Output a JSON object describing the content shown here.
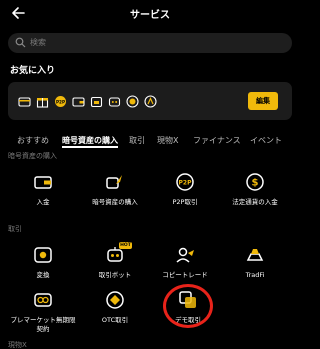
{
  "header": {
    "title": "サービス"
  },
  "search": {
    "placeholder": "検索"
  },
  "favorites": {
    "title": "お気に入り",
    "edit_label": "編集",
    "icons": [
      "card-icon",
      "gift-icon",
      "p2p-icon",
      "wallet-icon",
      "calendar-icon",
      "bot-icon",
      "coin-icon",
      "ai-icon"
    ]
  },
  "tabs": [
    {
      "label": "おすすめ"
    },
    {
      "label": "暗号資産の購入"
    },
    {
      "label": "取引"
    },
    {
      "label": "現物X"
    },
    {
      "label": "ファイナンス"
    },
    {
      "label": "イベント"
    }
  ],
  "sections": {
    "buy": {
      "title": "暗号資産の購入",
      "items": [
        {
          "label": "入金",
          "icon": "wallet-icon"
        },
        {
          "label": "暗号資産の購入",
          "icon": "rocket-icon"
        },
        {
          "label": "P2P取引",
          "icon": "p2p-icon"
        },
        {
          "label": "法定通貨の入金",
          "icon": "dollar-icon"
        }
      ]
    },
    "trade": {
      "title": "取引",
      "items": [
        {
          "label": "変換",
          "icon": "convert-icon"
        },
        {
          "label": "取引ボット",
          "icon": "bot-icon",
          "badge": "HOT"
        },
        {
          "label": "コピートレード",
          "icon": "copy-trade-icon"
        },
        {
          "label": "TradFi",
          "icon": "gold-icon"
        },
        {
          "label": "プレマーケット無期限契約",
          "icon": "premarket-icon"
        },
        {
          "label": "OTC取引",
          "icon": "otc-icon"
        },
        {
          "label": "デモ取引",
          "icon": "demo-icon"
        }
      ]
    },
    "spot": {
      "title": "現物X"
    }
  },
  "colors": {
    "accent": "#f0b90b",
    "highlight": "#e8231a",
    "background": "#000000"
  }
}
